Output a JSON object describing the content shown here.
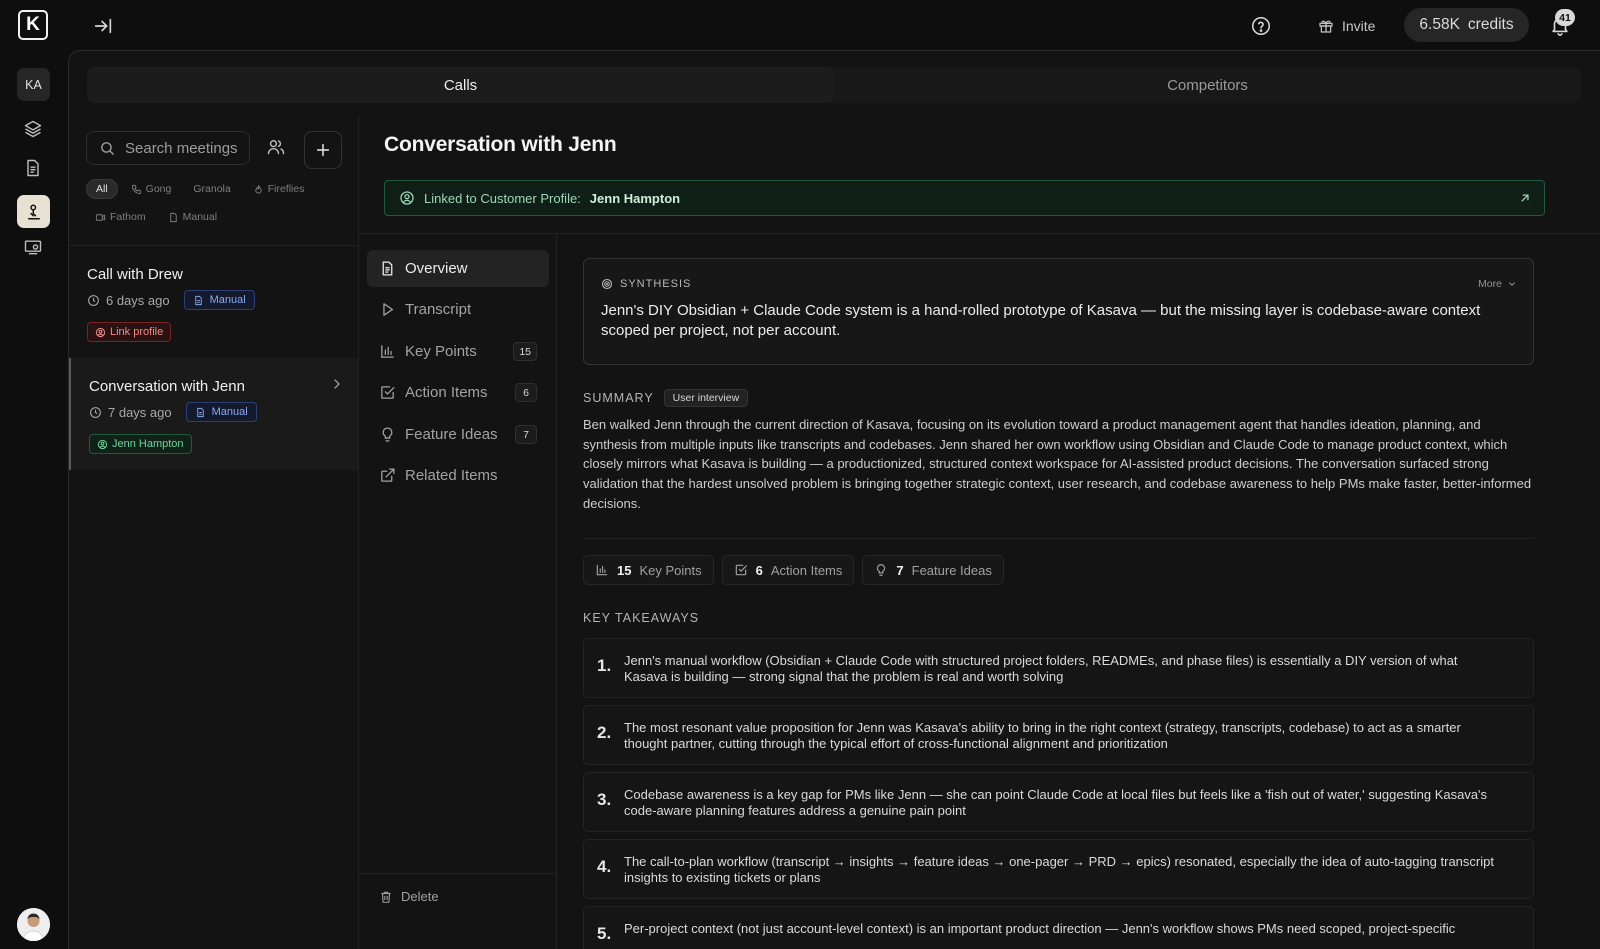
{
  "topbar": {
    "logo": "K",
    "invite_label": "Invite",
    "credits_value": "6.58K",
    "credits_label": "credits",
    "notifications_count": "41"
  },
  "rail": {
    "workspace_initials": "KA"
  },
  "tabs": [
    {
      "label": "Calls",
      "active": true
    },
    {
      "label": "Competitors",
      "active": false
    }
  ],
  "list": {
    "search_placeholder": "Search meetings",
    "filters": [
      "All",
      "Gong",
      "Granola",
      "Fireflies",
      "Fathom",
      "Manual"
    ],
    "meetings": [
      {
        "title": "Call with Drew",
        "time": "6 days ago",
        "source": "Manual",
        "tag": "Link profile"
      },
      {
        "title": "Conversation with Jenn",
        "time": "7 days ago",
        "source": "Manual",
        "tag": "Jenn Hampton"
      }
    ]
  },
  "detail": {
    "title": "Conversation with Jenn",
    "linked_prefix": "Linked to Customer Profile:",
    "linked_name": "Jenn Hampton",
    "nav": [
      {
        "label": "Overview",
        "count": null
      },
      {
        "label": "Transcript",
        "count": null
      },
      {
        "label": "Key Points",
        "count": "15"
      },
      {
        "label": "Action Items",
        "count": "6"
      },
      {
        "label": "Feature Ideas",
        "count": "7"
      },
      {
        "label": "Related Items",
        "count": null
      }
    ],
    "delete_label": "Delete",
    "synthesis": {
      "label": "SYNTHESIS",
      "more": "More",
      "text": "Jenn's DIY Obsidian + Claude Code system is a hand-rolled prototype of Kasava — but the missing layer is codebase-aware context scoped per project, not per account."
    },
    "summary": {
      "label": "SUMMARY",
      "badge": "User interview",
      "text": "Ben walked Jenn through the current direction of Kasava, focusing on its evolution toward a product management agent that handles ideation, planning, and synthesis from multiple inputs like transcripts and codebases. Jenn shared her own workflow using Obsidian and Claude Code to manage product context, which closely mirrors what Kasava is building — a productionized, structured context workspace for AI-assisted product decisions. The conversation surfaced strong validation that the hardest unsolved problem is bringing together strategic context, user research, and codebase awareness to help PMs make faster, better-informed decisions."
    },
    "stats": [
      {
        "value": "15",
        "label": "Key Points"
      },
      {
        "value": "6",
        "label": "Action Items"
      },
      {
        "value": "7",
        "label": "Feature Ideas"
      }
    ],
    "key_takeaways_label": "KEY TAKEAWAYS",
    "takeaways": [
      {
        "num": "1.",
        "text": "Jenn's manual workflow (Obsidian + Claude Code with structured project folders, READMEs, and phase files) is essentially a DIY version of what Kasava is building — strong signal that the problem is real and worth solving"
      },
      {
        "num": "2.",
        "text": "The most resonant value proposition for Jenn was Kasava's ability to bring in the right context (strategy, transcripts, codebase) to act as a smarter thought partner, cutting through the typical effort of cross-functional alignment and prioritization"
      },
      {
        "num": "3.",
        "text": "Codebase awareness is a key gap for PMs like Jenn — she can point Claude Code at local files but feels like a 'fish out of water,' suggesting Kasava's code-aware planning features address a genuine pain point"
      },
      {
        "num": "4.",
        "text": "The call-to-plan workflow (transcript → insights → feature ideas → one-pager → PRD → epics) resonated, especially the idea of auto-tagging transcript insights to existing tickets or plans"
      },
      {
        "num": "5.",
        "text": "Per-project context (not just account-level context) is an important product direction — Jenn's workflow shows PMs need scoped, project-specific"
      }
    ]
  },
  "colors": {
    "background": "#0e0e0e",
    "panel": "#131313",
    "accent_green": "#6fd39c",
    "accent_blue": "#8da8f0",
    "accent_red": "#f08a8a"
  }
}
